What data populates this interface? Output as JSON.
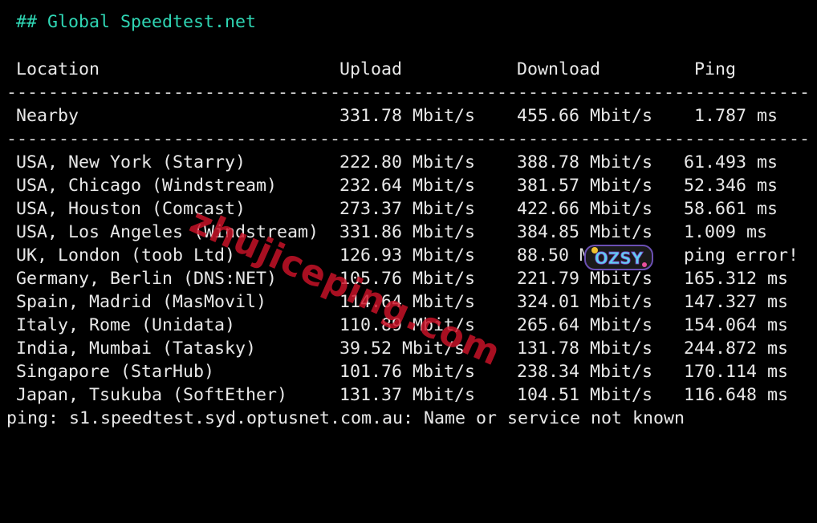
{
  "terminal": {
    "heading": "## Global Speedtest.net",
    "columns": {
      "location": "Location",
      "upload": "Upload",
      "download": "Download",
      "ping": "Ping"
    },
    "rule": "-----------------------------------------------------------------------------",
    "nearby": {
      "location": "Nearby",
      "upload": "331.78 Mbit/s",
      "download": "455.66 Mbit/s",
      "ping": "1.787 ms"
    },
    "rows": [
      {
        "location": "USA, New York (Starry)",
        "upload": "222.80 Mbit/s",
        "download": "388.78 Mbit/s",
        "ping": "61.493 ms"
      },
      {
        "location": "USA, Chicago (Windstream)",
        "upload": "232.64 Mbit/s",
        "download": "381.57 Mbit/s",
        "ping": "52.346 ms"
      },
      {
        "location": "USA, Houston (Comcast)",
        "upload": "273.37 Mbit/s",
        "download": "422.66 Mbit/s",
        "ping": "58.661 ms"
      },
      {
        "location": "USA, Los Angeles (Windstream)",
        "upload": "331.86 Mbit/s",
        "download": "384.85 Mbit/s",
        "ping": "1.009 ms"
      },
      {
        "location": "UK, London (toob Ltd)",
        "upload": "126.93 Mbit/s",
        "download": "88.50 Mbit/s",
        "ping": "ping error!"
      },
      {
        "location": "Germany, Berlin (DNS:NET)",
        "upload": "105.76 Mbit/s",
        "download": "221.79 Mbit/s",
        "ping": "165.312 ms"
      },
      {
        "location": "Spain, Madrid (MasMovil)",
        "upload": "114.64 Mbit/s",
        "download": "324.01 Mbit/s",
        "ping": "147.327 ms"
      },
      {
        "location": "Italy, Rome (Unidata)",
        "upload": "110.89 Mbit/s",
        "download": "265.64 Mbit/s",
        "ping": "154.064 ms"
      },
      {
        "location": "India, Mumbai (Tatasky)",
        "upload": "39.52 Mbit/s",
        "download": "131.78 Mbit/s",
        "ping": "244.872 ms"
      },
      {
        "location": "Singapore (StarHub)",
        "upload": "101.76 Mbit/s",
        "download": "238.34 Mbit/s",
        "ping": "170.114 ms"
      },
      {
        "location": "Japan, Tsukuba (SoftEther)",
        "upload": "131.37 Mbit/s",
        "download": "104.51 Mbit/s",
        "ping": "116.648 ms"
      }
    ],
    "footer": "ping: s1.speedtest.syd.optusnet.com.au: Name or service not known"
  },
  "watermark": {
    "text": "zhujiceping.com",
    "badge_text": "OZSY"
  },
  "colors": {
    "background": "#000000",
    "text": "#e8e8e8",
    "heading": "#2fd6b4",
    "watermark": "#cd1228"
  }
}
